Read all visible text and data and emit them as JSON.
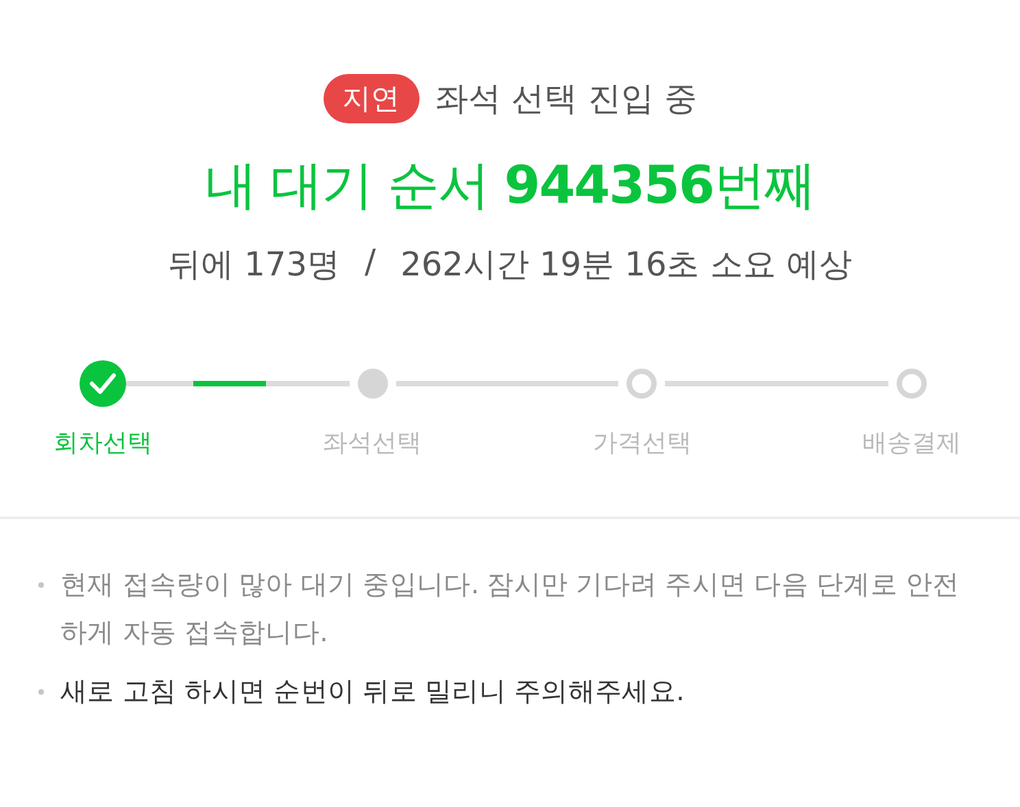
{
  "status": {
    "badge": "지연",
    "text": "좌석 선택 진입 중"
  },
  "queue": {
    "headline": "내 대기 순서 **944356**번째",
    "behind": "뒤에 173명",
    "separator": "/",
    "estimate": "262시간 19분 16초 소요 예상"
  },
  "steps": [
    {
      "label": "회차선택",
      "completed": true,
      "current": false
    },
    {
      "label": "좌석선택",
      "completed": false,
      "current": true
    },
    {
      "label": "가격선택",
      "completed": false,
      "current": false
    },
    {
      "label": "배송결제",
      "completed": false,
      "current": false
    }
  ],
  "notes": [
    {
      "text": "현재 접속량이 많아 대기 중입니다. 잠시만 기다려 주시면 다음 단계로 안전하게 자동 접속합니다.",
      "emphasis": false
    },
    {
      "text": "새로 고침 하시면 순번이 뒤로 밀리니 주의해주세요.",
      "emphasis": true
    }
  ]
}
